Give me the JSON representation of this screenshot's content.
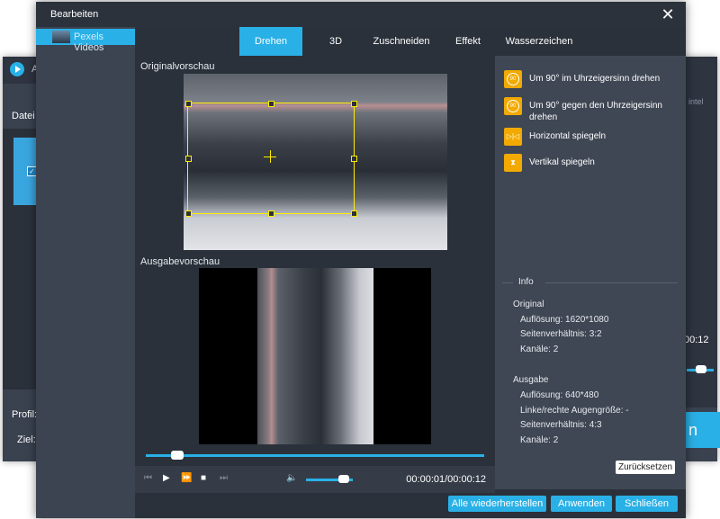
{
  "background_app": {
    "title": "A",
    "menu_label": "Datei l",
    "profile_label": "Profil:",
    "target_label": "Ziel:",
    "intel_badge": "intel",
    "time_display": "00:12",
    "convert_label": "n"
  },
  "dialog": {
    "title": "Bearbeiten",
    "close_label": "✕",
    "sidebar": {
      "items": [
        {
          "label": "Pexels Videos"
        }
      ]
    },
    "tabs": [
      {
        "label": "Drehen",
        "active": true
      },
      {
        "label": "3D",
        "active": false
      },
      {
        "label": "Zuschneiden",
        "active": false
      },
      {
        "label": "Effekt",
        "active": false
      },
      {
        "label": "Wasserzeichen",
        "active": false
      }
    ],
    "original_preview_label": "Originalvorschau",
    "output_preview_label": "Ausgabevorschau",
    "player": {
      "progress": 0.08,
      "volume": 0.8,
      "timecode": "00:00:01/00:00:12",
      "prev_icon": "skip-back-icon",
      "play_icon": "play-icon",
      "forward_icon": "fast-forward-icon",
      "stop_icon": "stop-icon",
      "next_icon": "skip-forward-icon",
      "volume_icon": "speaker-icon"
    },
    "rotate_options": [
      {
        "label": "Um 90° im Uhrzeigersinn drehen",
        "icon": "rotate-cw-icon",
        "badge": "90"
      },
      {
        "label": "Um 90° gegen den Uhrzeigersinn drehen",
        "icon": "rotate-ccw-icon",
        "badge": "90"
      },
      {
        "label": "Horizontal spiegeln",
        "icon": "flip-horizontal-icon",
        "badge": "▷|◁"
      },
      {
        "label": "Vertikal spiegeln",
        "icon": "flip-vertical-icon",
        "badge": "⧗"
      }
    ],
    "info": {
      "title": "Info",
      "original_heading": "Original",
      "original": [
        "Auflösung: 1620*1080",
        "Seitenverhältnis: 3:2",
        "Kanäle: 2"
      ],
      "output_heading": "Ausgabe",
      "output": [
        "Auflösung: 640*480",
        "Linke/rechte Augengröße: -",
        "Seitenverhältnis: 4:3",
        "Kanäle: 2"
      ]
    },
    "reset_label": "Zurücksetzen",
    "buttons": {
      "restore_all": "Alle wiederherstellen",
      "apply": "Anwenden",
      "close": "Schließen"
    }
  },
  "colors": {
    "accent": "#29b0e6",
    "rotate_icon": "#f2a900",
    "crop_frame": "#ffee00"
  }
}
